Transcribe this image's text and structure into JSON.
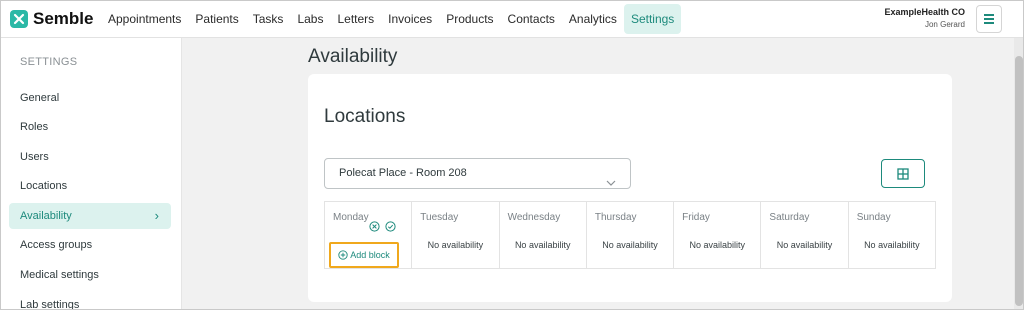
{
  "brand": {
    "name": "Semble",
    "accent": "#2bb8a6"
  },
  "nav": {
    "items": [
      "Appointments",
      "Patients",
      "Tasks",
      "Labs",
      "Letters",
      "Invoices",
      "Products",
      "Contacts",
      "Analytics",
      "Settings"
    ],
    "active": "Settings"
  },
  "account": {
    "org": "ExampleHealth CO",
    "user": "Jon Gerard"
  },
  "sidebar": {
    "heading": "SETTINGS",
    "items": [
      "General",
      "Roles",
      "Users",
      "Locations",
      "Availability",
      "Access groups",
      "Medical settings",
      "Lab settings"
    ],
    "active": "Availability"
  },
  "page": {
    "title": "Availability"
  },
  "card": {
    "title": "Locations",
    "location_select": {
      "value": "Polecat Place - Room 208"
    },
    "days": [
      {
        "name": "Monday",
        "status": "",
        "add_label": "Add block"
      },
      {
        "name": "Tuesday",
        "status": "No availability"
      },
      {
        "name": "Wednesday",
        "status": "No availability"
      },
      {
        "name": "Thursday",
        "status": "No availability"
      },
      {
        "name": "Friday",
        "status": "No availability"
      },
      {
        "name": "Saturday",
        "status": "No availability"
      },
      {
        "name": "Sunday",
        "status": "No availability"
      }
    ]
  },
  "colors": {
    "accent": "#1d8a7c",
    "highlight": "#f0a81c",
    "active_bg": "#dcf2ee"
  }
}
